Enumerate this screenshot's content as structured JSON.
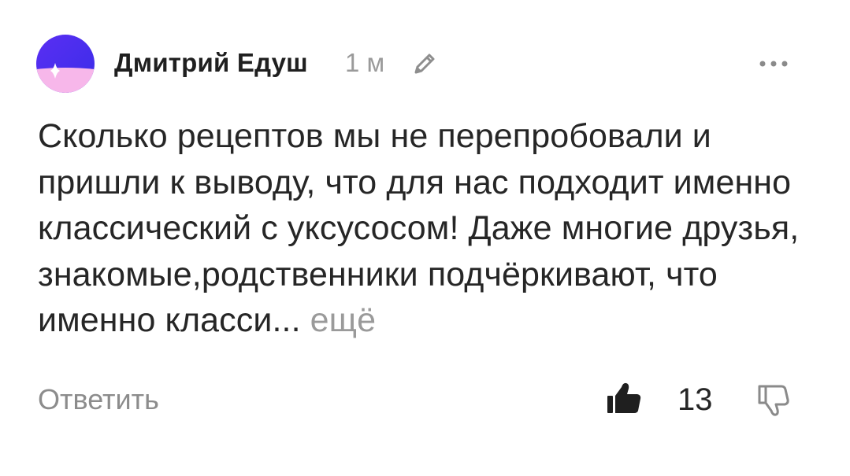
{
  "comment": {
    "author": "Дмитрий Едуш",
    "time": "1 м",
    "text": "Сколько рецептов мы не перепробовали и пришли к выводу, что для нас подходит именно классический с уксусосом! Даже многие друзья, знакомые,родственники подчёркивают, что именно класси...",
    "more_label": "ещё",
    "reply_label": "Ответить",
    "likes": "13"
  },
  "icons": {
    "avatar": "avatar-gradient",
    "edit": "pencil-icon",
    "more": "ellipsis-icon",
    "like": "thumbs-up-filled-icon",
    "dislike": "thumbs-down-outline-icon"
  },
  "colors": {
    "avatar_top": "#4a2ef2",
    "avatar_bottom": "#f7b7ea",
    "muted": "#9a9a9a",
    "text": "#262626"
  }
}
